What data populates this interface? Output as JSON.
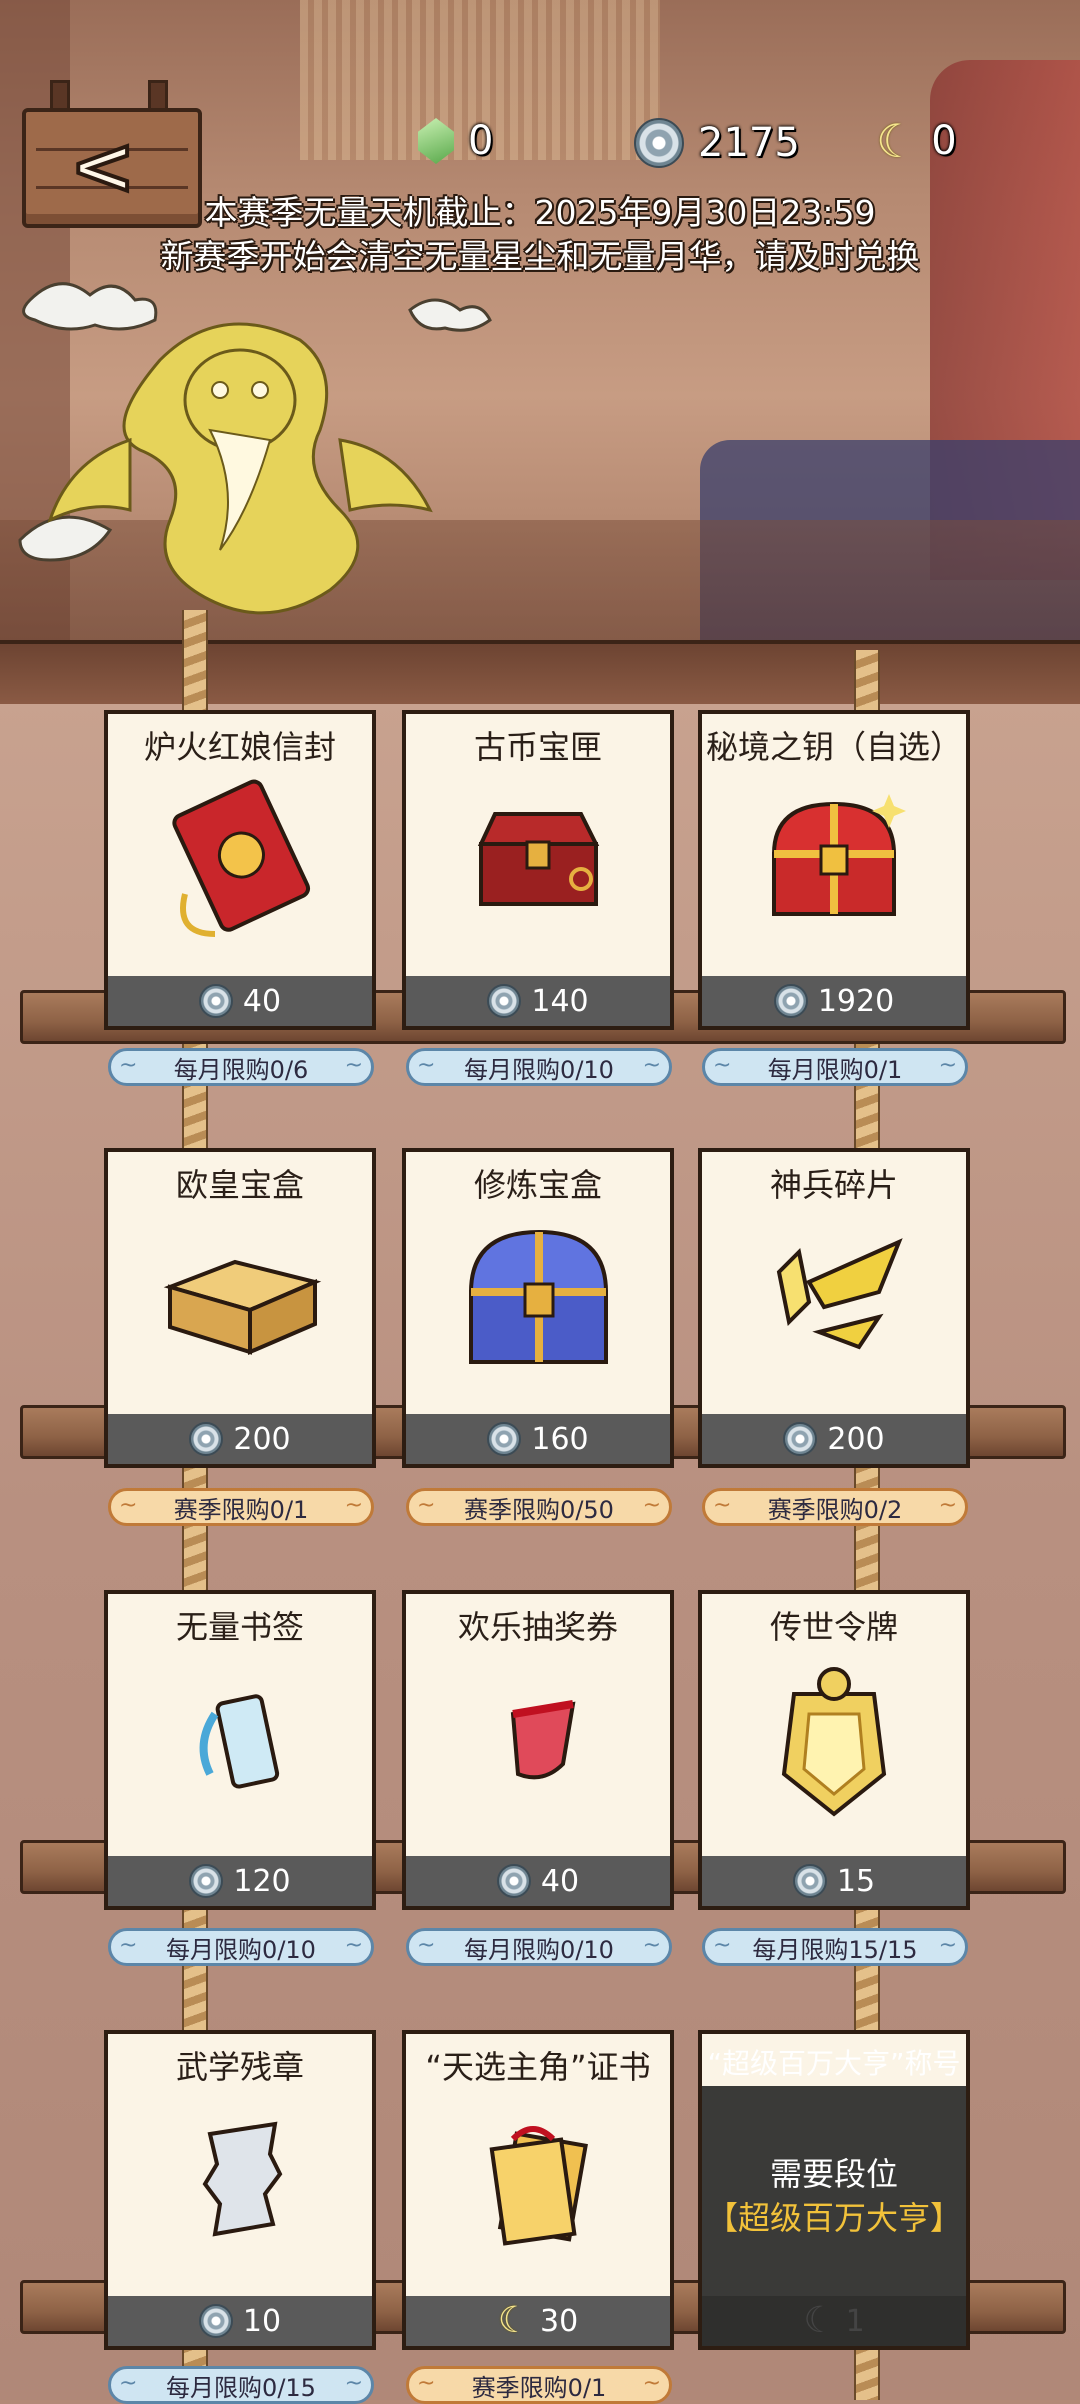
{
  "header": {
    "currencies": [
      {
        "icon": "jade-gem-icon",
        "value": "0"
      },
      {
        "icon": "silver-coin-icon",
        "value": "2175"
      },
      {
        "icon": "moon-icon",
        "value": "0"
      }
    ],
    "notice_line1": "本赛季无量天机截止：2025年9月30日23:59",
    "notice_line2": "新赛季开始会清空无量星尘和无量月华，请及时兑换"
  },
  "items": [
    {
      "name": "炉火红娘信封",
      "price": "40",
      "currency": "coin",
      "limit": "每月限购0/6",
      "limit_type": "monthly",
      "icon": "red-envelope-icon"
    },
    {
      "name": "古币宝匣",
      "price": "140",
      "currency": "coin",
      "limit": "每月限购0/10",
      "limit_type": "monthly",
      "icon": "red-box-icon"
    },
    {
      "name": "秘境之钥（自选）",
      "price": "1920",
      "currency": "coin",
      "limit": "每月限购0/1",
      "limit_type": "monthly",
      "icon": "treasure-chest-icon"
    },
    {
      "name": "欧皇宝盒",
      "price": "200",
      "currency": "coin",
      "limit": "赛季限购0/1",
      "limit_type": "season",
      "icon": "golden-box-icon"
    },
    {
      "name": "修炼宝盒",
      "price": "160",
      "currency": "coin",
      "limit": "赛季限购0/50",
      "limit_type": "season",
      "icon": "blue-chest-icon"
    },
    {
      "name": "神兵碎片",
      "price": "200",
      "currency": "coin",
      "limit": "赛季限购0/2",
      "limit_type": "season",
      "icon": "weapon-shard-icon"
    },
    {
      "name": "无量书签",
      "price": "120",
      "currency": "coin",
      "limit": "每月限购0/10",
      "limit_type": "monthly",
      "icon": "bookmark-icon"
    },
    {
      "name": "欢乐抽奖券",
      "price": "40",
      "currency": "coin",
      "limit": "每月限购0/10",
      "limit_type": "monthly",
      "icon": "lottery-ticket-icon"
    },
    {
      "name": "传世令牌",
      "price": "15",
      "currency": "coin",
      "limit": "每月限购15/15",
      "limit_type": "monthly",
      "icon": "token-plaque-icon"
    },
    {
      "name": "武学残章",
      "price": "10",
      "currency": "coin",
      "limit": "每月限购0/15",
      "limit_type": "monthly",
      "icon": "torn-page-icon"
    },
    {
      "name": "“天选主角”证书",
      "price": "30",
      "currency": "moon",
      "limit": "赛季限购0/1",
      "limit_type": "season",
      "icon": "certificate-icon"
    },
    {
      "name": "“超级百万大亨”称号",
      "price": "1",
      "currency": "moon",
      "locked": true,
      "req_label": "需要段位",
      "req_rank": "【超级百万大亨】",
      "icon": "title-icon"
    }
  ],
  "colors": {
    "monthly_badge": "#cfe5f2",
    "season_badge": "#f7d9a8",
    "rank_text": "#f2c23a",
    "price_bar": "#5a5a5a"
  }
}
